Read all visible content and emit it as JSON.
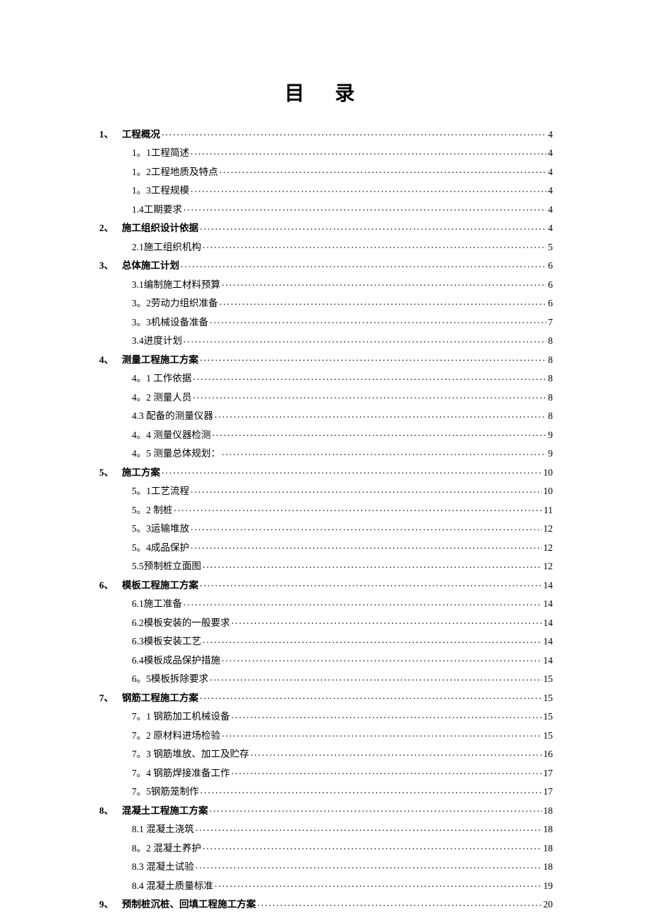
{
  "title": "目  录",
  "entries": [
    {
      "level": 0,
      "num": "1、",
      "text": "工程概况",
      "page": "4",
      "bold": true
    },
    {
      "level": 1,
      "num": "",
      "text": "1。1工程简述",
      "page": "4"
    },
    {
      "level": 1,
      "num": "",
      "text": "1。2工程地质及特点",
      "page": "4"
    },
    {
      "level": 1,
      "num": "",
      "text": "1。3工程规模",
      "page": "4"
    },
    {
      "level": 1,
      "num": "",
      "text": "1.4工期要求",
      "page": "4"
    },
    {
      "level": 0,
      "num": "2、",
      "text": "施工组织设计依据",
      "page": "4",
      "bold": true
    },
    {
      "level": 1,
      "num": "",
      "text": "2.1施工组织机构",
      "page": "5"
    },
    {
      "level": 0,
      "num": "3、",
      "text": "总体施工计划",
      "page": "6",
      "bold": true
    },
    {
      "level": 1,
      "num": "",
      "text": "3.1编制施工材料预算",
      "page": "6"
    },
    {
      "level": 1,
      "num": "",
      "text": "3。2劳动力组织准备",
      "page": "6"
    },
    {
      "level": 1,
      "num": "",
      "text": "3。3机械设备准备",
      "page": "7"
    },
    {
      "level": 1,
      "num": "",
      "text": "3.4进度计划",
      "page": "8"
    },
    {
      "level": 0,
      "num": "4、",
      "text": "测量工程施工方案",
      "page": "8",
      "bold": true
    },
    {
      "level": 1,
      "num": "",
      "text": "4。1 工作依据",
      "page": "8"
    },
    {
      "level": 1,
      "num": "",
      "text": "4。2 测量人员",
      "page": "8"
    },
    {
      "level": 1,
      "num": "",
      "text": "4.3 配备的测量仪器",
      "page": "8"
    },
    {
      "level": 1,
      "num": "",
      "text": "4。4 测量仪器检测",
      "page": "9"
    },
    {
      "level": 1,
      "num": "",
      "text": "4。5 测量总体规划：",
      "page": "9"
    },
    {
      "level": 0,
      "num": "5、",
      "text": "施工方案",
      "page": "10",
      "bold": true
    },
    {
      "level": 1,
      "num": "",
      "text": "5。1工艺流程",
      "page": "10"
    },
    {
      "level": 1,
      "num": "",
      "text": "5。2 制桩",
      "page": "11"
    },
    {
      "level": 1,
      "num": "",
      "text": "5。3运输堆放",
      "page": "12"
    },
    {
      "level": 1,
      "num": "",
      "text": "5。4成品保护",
      "page": "12"
    },
    {
      "level": 1,
      "num": "",
      "text": "5.5预制桩立面图",
      "page": "12"
    },
    {
      "level": 0,
      "num": "6、",
      "text": "模板工程施工方案",
      "page": "14",
      "bold": true
    },
    {
      "level": 1,
      "num": "",
      "text": "6.1施工准备",
      "page": "14"
    },
    {
      "level": 1,
      "num": "",
      "text": "6.2模板安装的一般要求",
      "page": "14"
    },
    {
      "level": 1,
      "num": "",
      "text": "6.3模板安装工艺",
      "page": "14"
    },
    {
      "level": 1,
      "num": "",
      "text": "6.4模板成品保护措施",
      "page": "14"
    },
    {
      "level": 1,
      "num": "",
      "text": "6。5模板拆除要求",
      "page": "15"
    },
    {
      "level": 0,
      "num": "7、",
      "text": "钢筋工程施工方案",
      "page": "15",
      "bold": true
    },
    {
      "level": 1,
      "num": "",
      "text": "7。1 钢筋加工机械设备",
      "page": "15"
    },
    {
      "level": 1,
      "num": "",
      "text": "7。2 原材料进场检验",
      "page": "15"
    },
    {
      "level": 1,
      "num": "",
      "text": "7。3 钢筋堆放、加工及贮存",
      "page": "16"
    },
    {
      "level": 1,
      "num": "",
      "text": "7。4 钢筋焊接准备工作",
      "page": "17"
    },
    {
      "level": 1,
      "num": "",
      "text": "7。5钢筋笼制作",
      "page": "17"
    },
    {
      "level": 0,
      "num": "8、",
      "text": "混凝土工程施工方案",
      "page": "18",
      "bold": true
    },
    {
      "level": 1,
      "num": "",
      "text": "8.1 混凝土浇筑",
      "page": "18"
    },
    {
      "level": 1,
      "num": "",
      "text": "8。2 混凝土养护",
      "page": "18"
    },
    {
      "level": 1,
      "num": "",
      "text": "8.3 混凝土试验",
      "page": "18"
    },
    {
      "level": 1,
      "num": "",
      "text": "8.4 混凝土质量标准",
      "page": "19"
    },
    {
      "level": 0,
      "num": "9、",
      "text": "预制桩沉桩、回填工程施工方案",
      "page": "20",
      "bold": true
    }
  ]
}
